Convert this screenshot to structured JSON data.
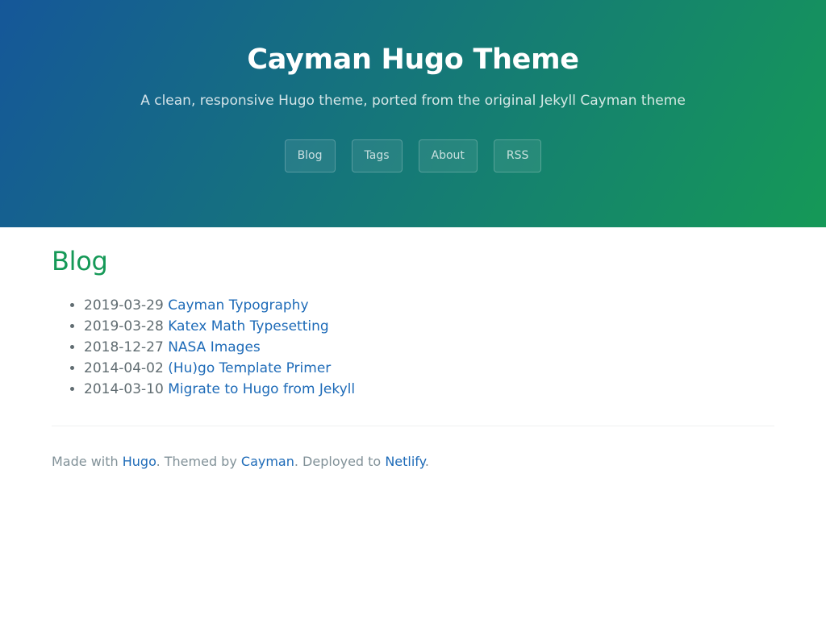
{
  "header": {
    "title": "Cayman Hugo Theme",
    "tagline": "A clean, responsive Hugo theme, ported from the original Jekyll Cayman theme",
    "nav": [
      {
        "label": "Blog"
      },
      {
        "label": "Tags"
      },
      {
        "label": "About"
      },
      {
        "label": "RSS"
      }
    ],
    "gradient_colors": [
      "#155799",
      "#159957"
    ]
  },
  "main": {
    "title": "Blog",
    "posts": [
      {
        "date": "2019-03-29",
        "title": "Cayman Typography"
      },
      {
        "date": "2019-03-28",
        "title": "Katex Math Typesetting"
      },
      {
        "date": "2018-12-27",
        "title": "NASA Images"
      },
      {
        "date": "2014-04-02",
        "title": "(Hu)go Template Primer"
      },
      {
        "date": "2014-03-10",
        "title": "Migrate to Hugo from Jekyll"
      }
    ]
  },
  "footer": {
    "made_with": "Made with ",
    "hugo_link": "Hugo",
    "themed_by": ". Themed by ",
    "cayman_link": "Cayman",
    "deployed_to": ". Deployed to ",
    "netlify_link": "Netlify",
    "end": "."
  },
  "colors": {
    "title_green": "#159957",
    "link_blue": "#1e6bb8",
    "text_gray": "#606c71",
    "footer_gray": "#819198"
  }
}
